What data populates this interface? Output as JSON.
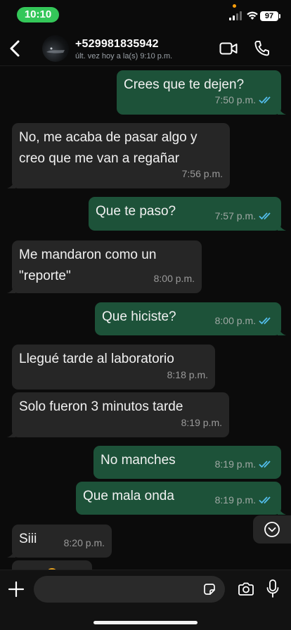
{
  "status_bar": {
    "time": "10:10",
    "battery": "97"
  },
  "header": {
    "contact": "+529981835942",
    "last_seen": "últ. vez hoy a la(s) 9:10 p.m."
  },
  "messages": [
    {
      "dir": "out",
      "text": "Crees que te dejen?",
      "time": "7:50 p.m.",
      "read": true
    },
    {
      "dir": "in",
      "text": "No, me acaba de pasar algo y\ncreo que me van a regañar",
      "time": "7:56 p.m."
    },
    {
      "dir": "out",
      "text": "Que te paso?",
      "time": "7:57 p.m.",
      "read": true
    },
    {
      "dir": "in",
      "text": "Me mandaron como un\n\"reporte\"",
      "time": "8:00 p.m."
    },
    {
      "dir": "out",
      "text": "Que hiciste?",
      "time": "8:00 p.m.",
      "read": true
    },
    {
      "dir": "in",
      "text": "Llegué tarde al laboratorio",
      "time": "8:18 p.m."
    },
    {
      "dir": "in",
      "text": "Solo fueron 3 minutos tarde",
      "time": "8:19 p.m."
    },
    {
      "dir": "out",
      "text": "No manches",
      "time": "8:19 p.m.",
      "read": true
    },
    {
      "dir": "out",
      "text": "Que mala onda",
      "time": "8:19 p.m.",
      "read": true
    },
    {
      "dir": "in",
      "text": "Siii",
      "time": "8:20 p.m."
    }
  ],
  "input": {
    "placeholder": ""
  },
  "colors": {
    "outgoing": "#1d5239",
    "incoming": "#262626",
    "read_ticks": "#53bdeb",
    "status_time": "#34c759"
  },
  "icons": [
    "back-icon",
    "video-call-icon",
    "phone-icon",
    "scroll-down-icon",
    "plus-icon",
    "sticker-icon",
    "camera-icon",
    "microphone-icon"
  ]
}
